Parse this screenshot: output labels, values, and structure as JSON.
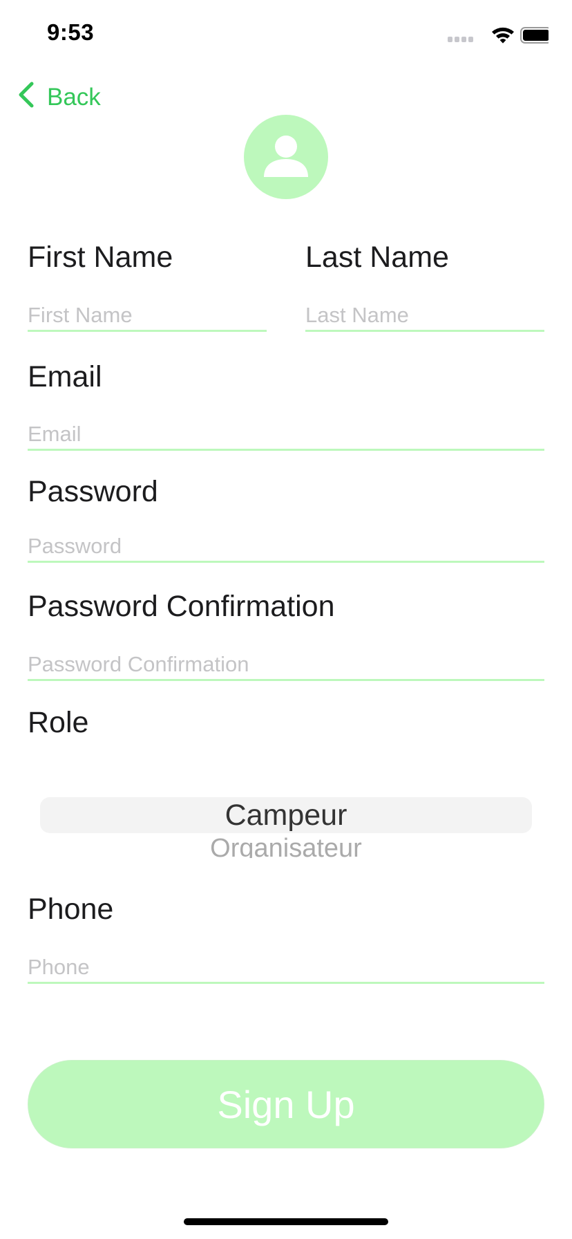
{
  "status_bar": {
    "time": "9:53",
    "icons": [
      "cellular-signal-icon",
      "wifi-icon",
      "battery-icon"
    ]
  },
  "nav": {
    "back_label": "Back",
    "back_icon": "chevron-left-icon"
  },
  "avatar": {
    "icon": "person-icon"
  },
  "form": {
    "first_name": {
      "label": "First Name",
      "placeholder": "First Name",
      "value": ""
    },
    "last_name": {
      "label": "Last Name",
      "placeholder": "Last Name",
      "value": ""
    },
    "email": {
      "label": "Email",
      "placeholder": "Email",
      "value": ""
    },
    "password": {
      "label": "Password",
      "placeholder": "Password",
      "value": ""
    },
    "password_confirmation": {
      "label": "Password Confirmation",
      "placeholder": "Password Confirmation",
      "value": ""
    },
    "role": {
      "label": "Role",
      "selected": "Campeur",
      "options": [
        "Campeur",
        "Organisateur"
      ]
    },
    "phone": {
      "label": "Phone",
      "placeholder": "Phone",
      "value": ""
    }
  },
  "signup_button": {
    "label": "Sign Up"
  },
  "colors": {
    "accent": "#34c759",
    "light_green": "#bdf8bc",
    "placeholder": "#c4c4c6"
  }
}
